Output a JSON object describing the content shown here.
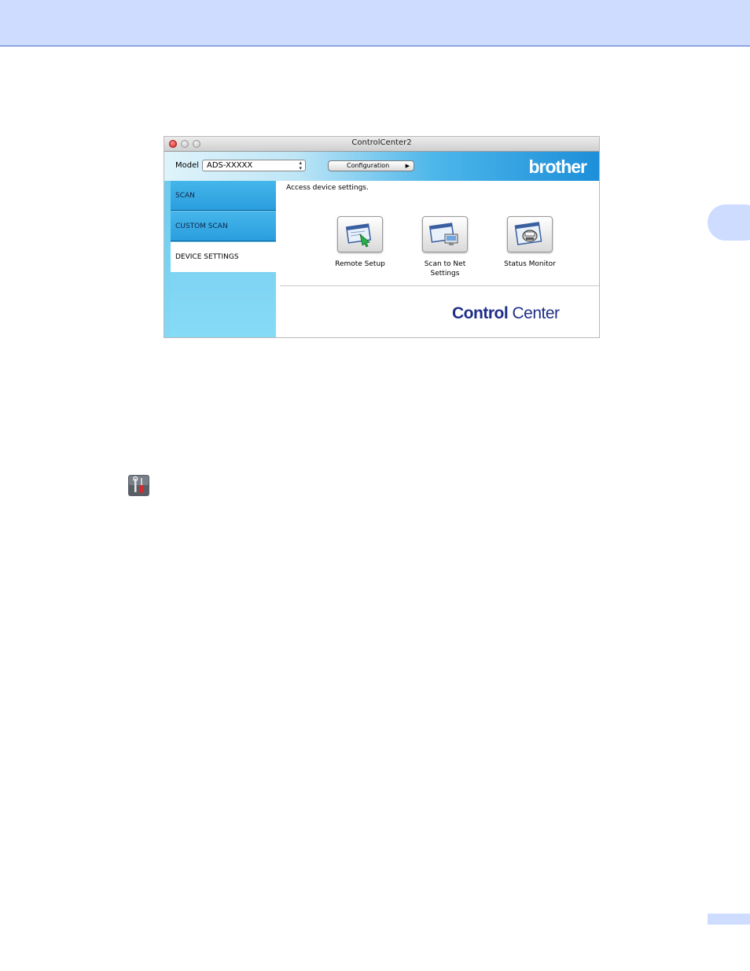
{
  "window": {
    "title": "ControlCenter2",
    "model_label": "Model",
    "model_value": "ADS-XXXXX",
    "configuration_label": "Configuration",
    "brand": "brother"
  },
  "sidebar": {
    "items": [
      {
        "label": "SCAN"
      },
      {
        "label": "CUSTOM SCAN"
      },
      {
        "label": "DEVICE SETTINGS"
      }
    ]
  },
  "content": {
    "instruction": "Access device settings.",
    "features": [
      {
        "label": "Remote Setup",
        "icon": "remote-setup-icon"
      },
      {
        "label": "Scan to Net Settings",
        "icon": "scan-to-net-icon"
      },
      {
        "label": "Status Monitor",
        "icon": "status-monitor-icon"
      }
    ],
    "logo_bold": "Control",
    "logo_light": " Center"
  },
  "colors": {
    "header": "#cddcff",
    "sidebar_blue": "#2a9ede",
    "logo_navy": "#1f2f88"
  }
}
